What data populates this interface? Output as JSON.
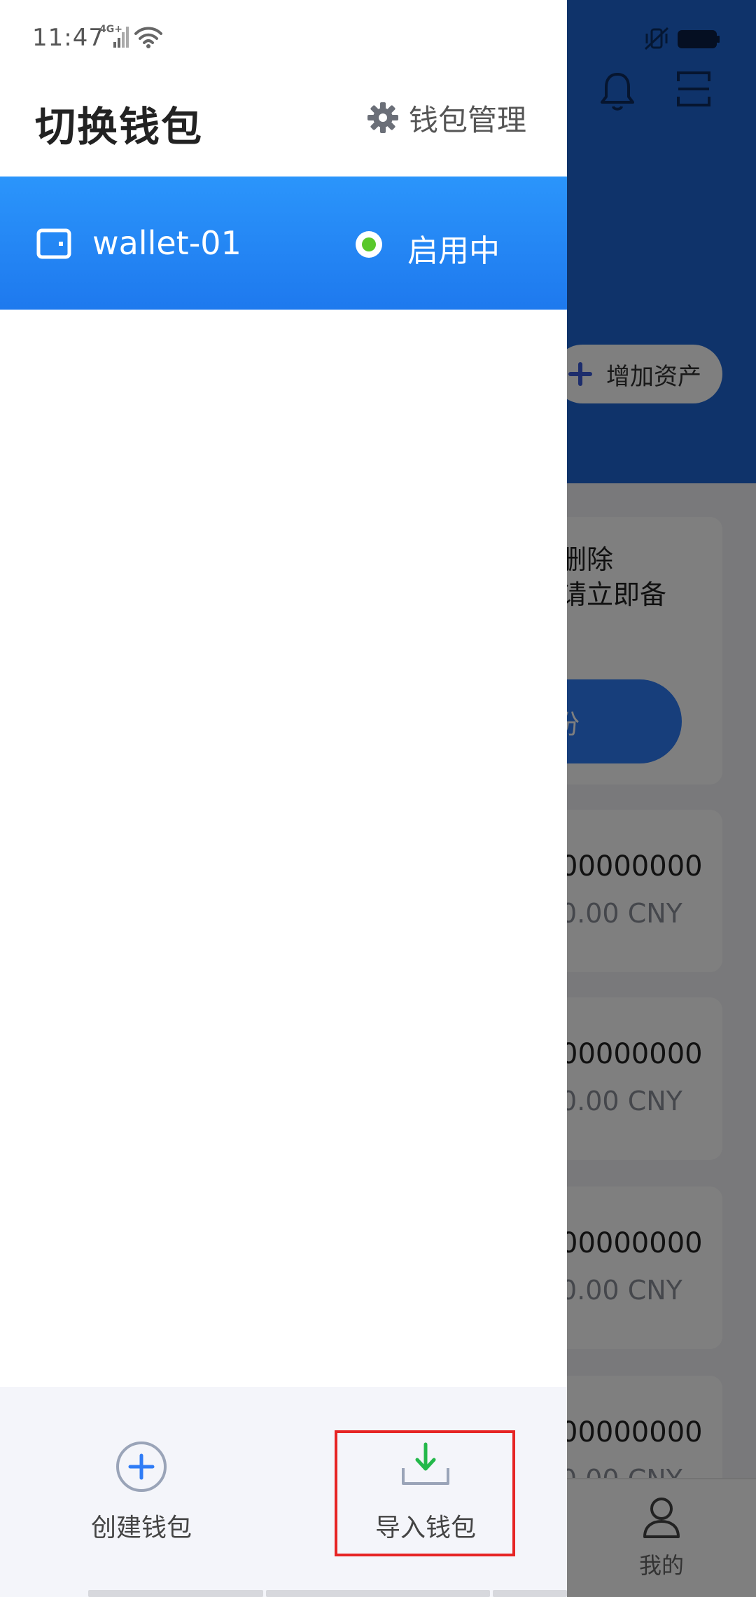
{
  "status_bar": {
    "time": "11:47",
    "network": "4G+",
    "wifi_icon": "wifi-icon"
  },
  "drawer": {
    "title": "切换钱包",
    "manage_label": "钱包管理",
    "manage_icon": "gear-icon",
    "wallets": [
      {
        "name": "wallet-01",
        "status": "启用中",
        "status_color": "#5ac82a",
        "icon": "wallet-icon"
      }
    ],
    "active_color": "#1e79ee",
    "footer": {
      "create_label": "创建钱包",
      "create_icon": "plus-circle-icon",
      "import_label": "导入钱包",
      "import_icon": "download-tray-icon",
      "highlight_color": "#e62424"
    }
  },
  "background": {
    "add_asset_label": "增加资产",
    "backup_text_line1": "删除",
    "backup_text_line2": "请立即备",
    "backup_button": "份",
    "assets": [
      {
        "amount": "00000000",
        "fiat": "0.00 CNY"
      },
      {
        "amount": "00000000",
        "fiat": "0.00 CNY"
      },
      {
        "amount": "00000000",
        "fiat": "0.00 CNY"
      },
      {
        "amount": "00000000",
        "fiat": "0.00 CNY"
      }
    ],
    "tab_me_label": "我的",
    "header_color": "#1f66d4"
  }
}
